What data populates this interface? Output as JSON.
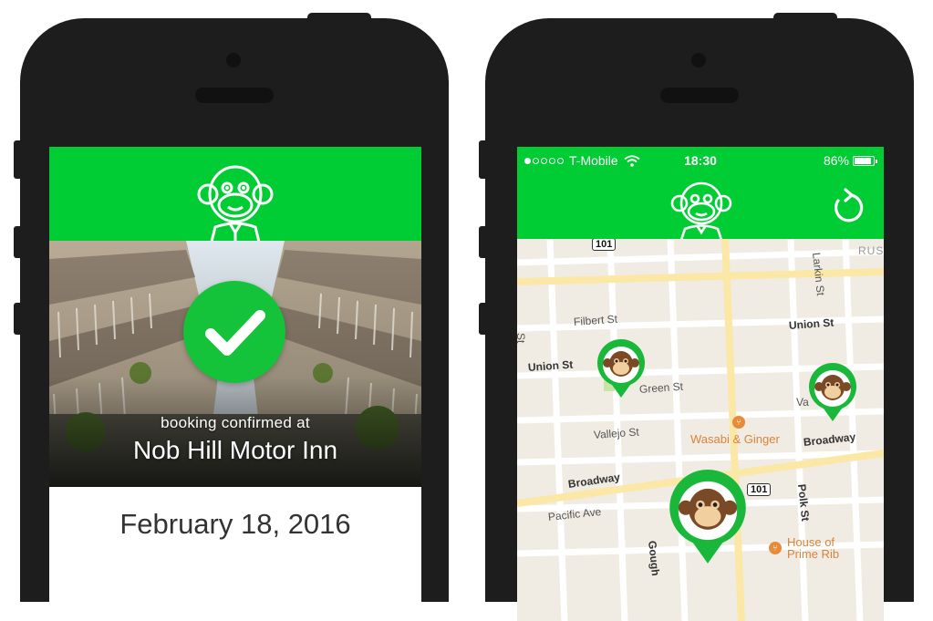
{
  "left_phone": {
    "booking": {
      "confirm_label": "booking confirmed at",
      "hotel_name": "Nob Hill Motor Inn"
    },
    "date": "February 18, 2016"
  },
  "right_phone": {
    "status_bar": {
      "carrier": "T-Mobile",
      "signal_bars": 1,
      "time": "18:30",
      "battery": "86%"
    },
    "map": {
      "streets": {
        "filbert": "Filbert St",
        "union_left": "Union St",
        "union_right": "Union St",
        "green": "Green St",
        "vallejo": "Vallejo St",
        "broadway_left": "Broadway",
        "broadway_right": "Broadway",
        "pacific": "Pacific Ave",
        "larkin": "Larkin St",
        "polk": "Polk St",
        "gough": "Gough",
        "ru": "RUS",
        "side": "Va",
        "left_edge": "St"
      },
      "highway_shield_top": "101",
      "highway_shield_bottom": "101",
      "pois": {
        "wasabi": "Wasabi & Ginger",
        "house": "House of",
        "house2": "Prime Rib"
      }
    }
  },
  "colors": {
    "brand_green": "#00cc33",
    "check_green": "#14c33a",
    "poi_orange": "#e58b3a"
  },
  "icons": [
    "monkey-mascot-icon",
    "checkmark-icon",
    "refresh-icon",
    "wifi-icon",
    "battery-icon",
    "restaurant-icon",
    "monkey-pin-icon"
  ]
}
